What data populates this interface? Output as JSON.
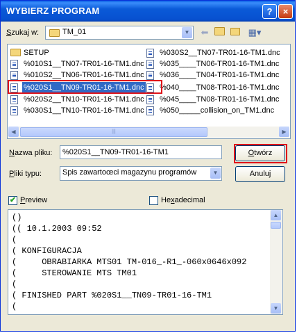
{
  "window": {
    "title": "WYBIERZ PROGRAM",
    "help_label": "?",
    "close_label": "×"
  },
  "lookin": {
    "label_prefix": "S",
    "label_rest": "zukaj w:",
    "value": "TM_01"
  },
  "toolbar": {
    "back_icon": "back-arrow-icon",
    "up_icon": "up-folder-icon",
    "new_icon": "new-folder-icon",
    "views_icon": "views-menu-icon"
  },
  "files": [
    {
      "name": "SETUP",
      "type": "folder",
      "selected": false
    },
    {
      "name": "%010S1__TN07-TR01-16-TM1.dnc",
      "type": "file",
      "selected": false
    },
    {
      "name": "%010S2__TN06-TR01-16-TM1.dnc",
      "type": "file",
      "selected": false
    },
    {
      "name": "%020S1__TN09-TR01-16-TM1.dnc",
      "type": "file",
      "selected": true
    },
    {
      "name": "%020S2__TN10-TR01-16-TM1.dnc",
      "type": "file",
      "selected": false
    },
    {
      "name": "%030S1__TN10-TR01-16-TM1.dnc",
      "type": "file",
      "selected": false
    },
    {
      "name": "%030S2__TN07-TR01-16-TM1.dnc",
      "type": "file",
      "selected": false
    },
    {
      "name": "%035____TN06-TR01-16-TM1.dnc",
      "type": "file",
      "selected": false
    },
    {
      "name": "%036____TN04-TR01-16-TM1.dnc",
      "type": "file",
      "selected": false
    },
    {
      "name": "%040____TN08-TR01-16-TM1.dnc",
      "type": "file",
      "selected": false
    },
    {
      "name": "%045____TN08-TR01-16-TM1.dnc",
      "type": "file",
      "selected": false
    },
    {
      "name": "%050_____collision_on_TM1.dnc",
      "type": "file",
      "selected": false
    }
  ],
  "filename": {
    "label_prefix": "N",
    "label_rest": "azwa pliku:",
    "value": "%020S1__TN09-TR01-16-TM1"
  },
  "filetype": {
    "label_prefix": "P",
    "label_rest": "liki typu:",
    "value": "Spis zawartoœci magazynu programów"
  },
  "buttons": {
    "open_prefix": "O",
    "open_rest": "twórz",
    "cancel": "Anuluj"
  },
  "preview_check": {
    "prefix": "P",
    "rest": "review",
    "checked": true
  },
  "hex_check": {
    "prefix": "He",
    "underlined": "x",
    "rest": "adecimal",
    "checked": false
  },
  "preview_lines": [
    "()",
    "(( 10.1.2003 09:52",
    "(",
    "( KONFIGURACJA",
    "(     OBRABIARKA MTS01 TM-016_-R1_-060x0646x092",
    "(     STEROWANIE MTS TM01",
    "(",
    "( FINISHED PART %020S1__TN09-TR01-16-TM1",
    "("
  ],
  "scroll_glyphs": {
    "left": "◀",
    "right": "▶",
    "up": "▲",
    "down": "▼",
    "dropdown": "▼",
    "grip": "|||",
    "check": "✔"
  },
  "colors": {
    "selection": "#316ac5",
    "highlight_box": "#e0141a",
    "titlebar": "#0a5ad8"
  }
}
